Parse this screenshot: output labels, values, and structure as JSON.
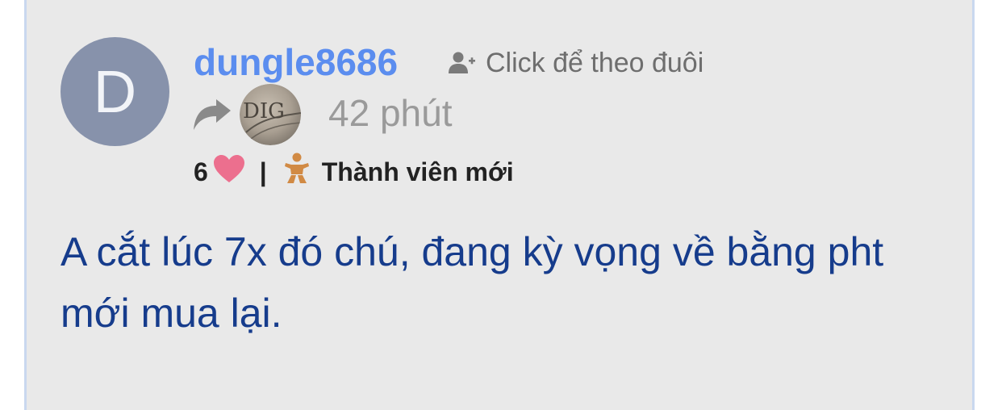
{
  "comment": {
    "avatar_letter": "D",
    "username": "dungle8686",
    "follow_label": "Click để theo đuôi",
    "shared_avatar_text": "DIG",
    "time": "42 phút",
    "likes": "6",
    "separator": "|",
    "rank": "Thành viên mới",
    "body": "A cắt lúc 7x đó chú, đang kỳ vọng về bằng pht mới mua lại."
  },
  "colors": {
    "card_bg": "#e9e9e9",
    "username": "#5b8def",
    "body_text": "#163c8c",
    "heart": "#ec6f8e",
    "avatar_bg": "#8792ab",
    "baby_icon": "#d18a44"
  },
  "icons": {
    "follow": "add-user-icon",
    "share": "share-arrow-icon",
    "like": "heart-icon",
    "rank": "baby-icon"
  }
}
